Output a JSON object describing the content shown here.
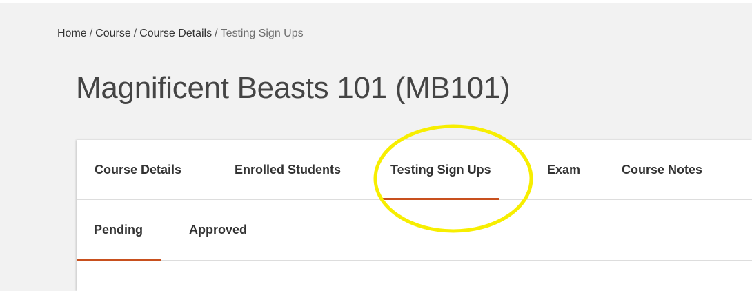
{
  "breadcrumb": {
    "items": [
      "Home",
      "Course",
      "Course Details"
    ],
    "separator": "/",
    "current": "Testing Sign Ups"
  },
  "page": {
    "title": "Magnificent Beasts 101 (MB101)"
  },
  "tabs": [
    {
      "label": "Course Details",
      "active": false
    },
    {
      "label": "Enrolled Students",
      "active": false
    },
    {
      "label": "Testing Sign Ups",
      "active": true
    },
    {
      "label": "Exam",
      "active": false
    },
    {
      "label": "Course Notes",
      "active": false
    }
  ],
  "subtabs": [
    {
      "label": "Pending",
      "active": true
    },
    {
      "label": "Approved",
      "active": false
    }
  ],
  "colors": {
    "accent": "#c8501e",
    "highlight": "#f7ee00",
    "background": "#f2f2f2",
    "card": "#ffffff"
  }
}
